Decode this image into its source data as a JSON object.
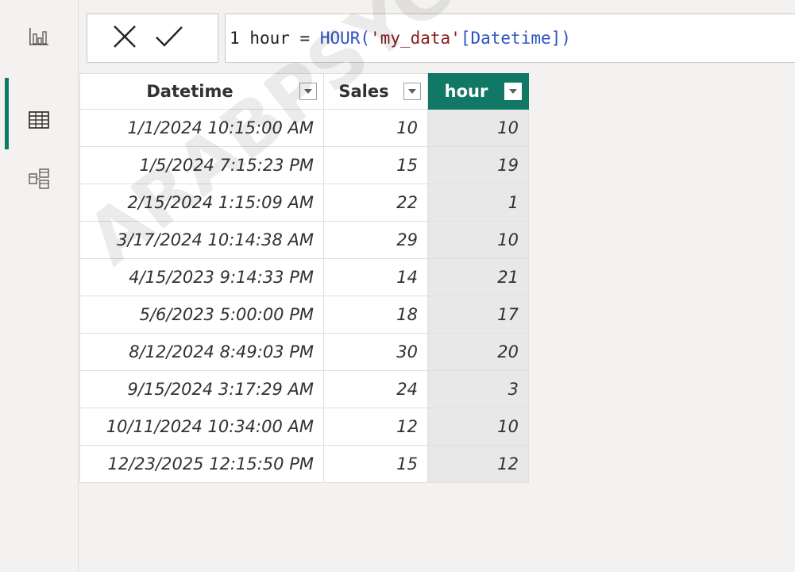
{
  "rail": {
    "items": [
      {
        "name": "report-view",
        "icon": "bar-chart-icon",
        "active": false
      },
      {
        "name": "table-view",
        "icon": "table-grid-icon",
        "active": true
      },
      {
        "name": "model-view",
        "icon": "model-diagram-icon",
        "active": false
      }
    ],
    "accent": "#117865"
  },
  "formula_bar": {
    "cancel_icon": "close-icon",
    "commit_icon": "check-icon",
    "line_number": "1",
    "expr_lhs": "hour = ",
    "expr_fn": "HOUR(",
    "expr_table": "'my_data'",
    "expr_col": "[Datetime]",
    "expr_close": ")"
  },
  "table": {
    "columns": [
      {
        "label": "Datetime",
        "selected": false
      },
      {
        "label": "Sales",
        "selected": false
      },
      {
        "label": "hour",
        "selected": true
      }
    ],
    "rows": [
      [
        "1/1/2024 10:15:00 AM",
        "10",
        "10"
      ],
      [
        "1/5/2024 7:15:23 PM",
        "15",
        "19"
      ],
      [
        "2/15/2024 1:15:09 AM",
        "22",
        "1"
      ],
      [
        "3/17/2024 10:14:38 AM",
        "29",
        "10"
      ],
      [
        "4/15/2023 9:14:33 PM",
        "14",
        "21"
      ],
      [
        "5/6/2023 5:00:00 PM",
        "18",
        "17"
      ],
      [
        "8/12/2024 8:49:03 PM",
        "30",
        "20"
      ],
      [
        "9/15/2024 3:17:29 AM",
        "24",
        "3"
      ],
      [
        "10/11/2024 10:34:00 AM",
        "12",
        "10"
      ],
      [
        "12/23/2025 12:15:50 PM",
        "15",
        "12"
      ]
    ]
  },
  "watermark": "ARABPSYCHO"
}
